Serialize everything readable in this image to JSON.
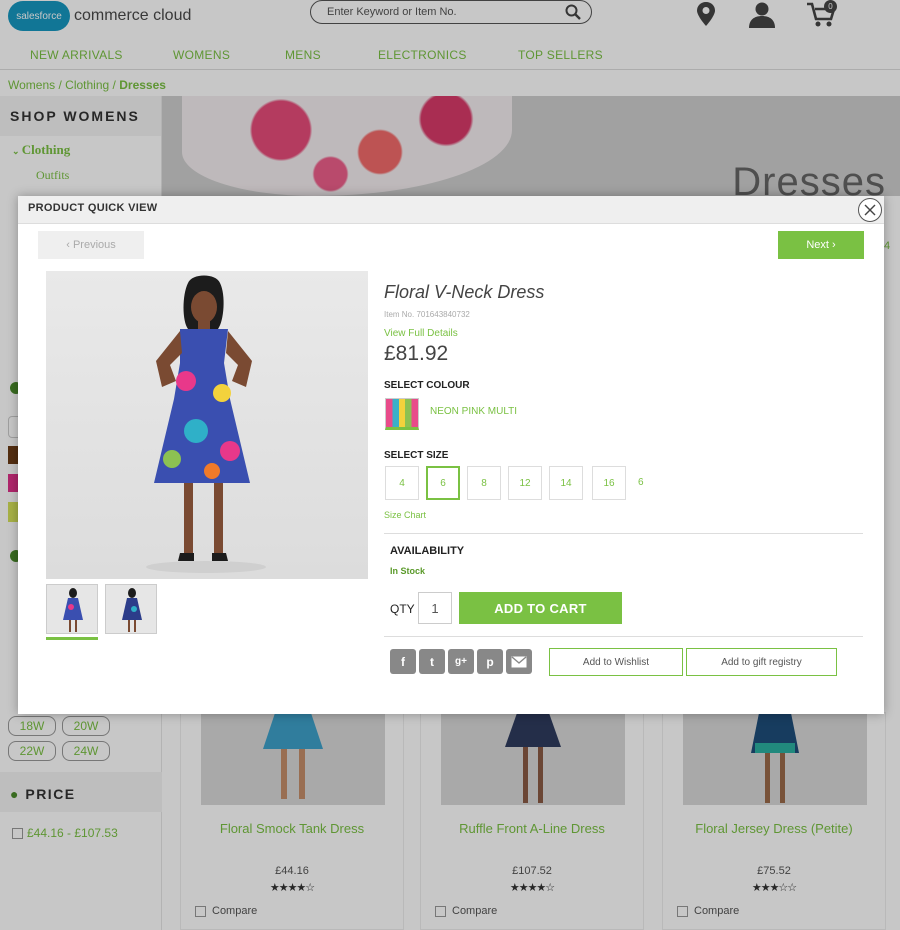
{
  "header": {
    "logo_badge": "salesforce",
    "logo_text": "commerce cloud",
    "search_placeholder": "Enter Keyword or Item No.",
    "cart_count": "0"
  },
  "nav": [
    "NEW ARRIVALS",
    "WOMENS",
    "MENS",
    "ELECTRONICS",
    "TOP SELLERS"
  ],
  "breadcrumb": {
    "part1": "Womens",
    "sep": "/",
    "part2": "Clothing",
    "part3": "Dresses"
  },
  "sidebar": {
    "title": "SHOP WOMENS",
    "category": "Clothing",
    "subitems": [
      "Outfits"
    ],
    "sizes": [
      "18W",
      "20W",
      "22W",
      "24W"
    ],
    "price_title": "PRICE",
    "price_option": "£44.16 - £107.53"
  },
  "hero": {
    "title": "Dresses",
    "edge_value": "4"
  },
  "products": [
    {
      "name": "Floral Smock Tank Dress",
      "price": "£44.16",
      "stars": "★★★★☆",
      "compare": "Compare"
    },
    {
      "name": "Ruffle Front A-Line Dress",
      "price": "£107.52",
      "stars": "★★★★☆",
      "compare": "Compare"
    },
    {
      "name": "Floral Jersey Dress (Petite)",
      "price": "£75.52",
      "stars": "★★★☆☆",
      "compare": "Compare"
    }
  ],
  "modal": {
    "title": "PRODUCT QUICK VIEW",
    "prev_label": "‹ Previous",
    "next_label": "Next ›",
    "product_name": "Floral V-Neck Dress",
    "item_no": "Item No. 701643840732",
    "view_details": "View Full Details",
    "price": "£81.92",
    "select_colour_label": "SELECT COLOUR",
    "colour_name": "NEON PINK MULTI",
    "select_size_label": "SELECT SIZE",
    "sizes": [
      "4",
      "6",
      "8",
      "12",
      "14",
      "16"
    ],
    "selected_size": "6",
    "size_chart": "Size Chart",
    "availability_label": "AVAILABILITY",
    "availability_status": "In Stock",
    "qty_label": "QTY",
    "qty_value": "1",
    "add_to_cart": "ADD TO CART",
    "social_icons": [
      "facebook-icon",
      "twitter-icon",
      "google-plus-icon",
      "pinterest-icon",
      "email-icon"
    ],
    "add_to_wishlist": "Add to Wishlist",
    "add_to_registry": "Add to gift registry"
  },
  "colors": {
    "accent": "#7ac143",
    "brand_blue": "#1798c1"
  }
}
